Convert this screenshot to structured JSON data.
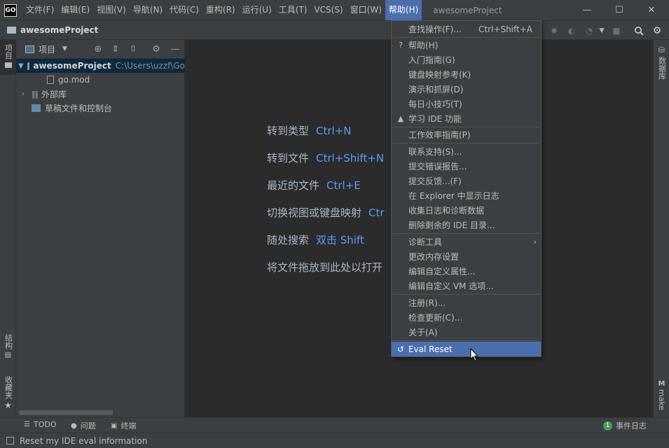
{
  "titlebar": {
    "logo": "GO",
    "menus": [
      "文件(F)",
      "编辑(E)",
      "视图(V)",
      "导航(N)",
      "代码(C)",
      "重构(R)",
      "运行(U)",
      "工具(T)",
      "VCS(S)",
      "窗口(W)",
      "帮助(H)"
    ],
    "active_menu": "帮助(H)",
    "window_title": "awesomeProject",
    "controls": {
      "minimize": "—",
      "maximize": "☐",
      "close": "✕"
    }
  },
  "navbar": {
    "project": "awesomeProject",
    "tool_icons": [
      "bug-icon",
      "coverage-icon",
      "profile-icon",
      "dropdown-icon",
      "stop-icon",
      "search-icon",
      "gear-icon"
    ]
  },
  "left_stripe": {
    "project_tab": "项目",
    "structure_tab": "结构",
    "favorites_tab": "收藏夹"
  },
  "right_stripe": {
    "database_tab": "数据库",
    "make_tab": "make"
  },
  "project_panel": {
    "title": "项目",
    "tree": {
      "root_name": "awesomeProject",
      "root_path": "C:\\Users\\uzzf\\Go",
      "child_file": "go.mod",
      "external_libs": "外部库",
      "scratches": "草稿文件和控制台"
    }
  },
  "editor": {
    "hints": [
      {
        "label": "转到类型",
        "key": "Ctrl+N"
      },
      {
        "label": "转到文件",
        "key": "Ctrl+Shift+N"
      },
      {
        "label": "最近的文件",
        "key": "Ctrl+E"
      },
      {
        "label": "切换视图或键盘映射",
        "key": "Ctr"
      },
      {
        "label": "随处搜索",
        "key": "双击 Shift"
      },
      {
        "label": "将文件拖放到此处以打开",
        "key": ""
      }
    ]
  },
  "help_menu": {
    "items": [
      {
        "label": "查找操作(F)...",
        "shortcut": "Ctrl+Shift+A"
      },
      {
        "label": "帮助(H)",
        "icon": "?"
      },
      {
        "label": "入门指南(G)"
      },
      {
        "label": "键盘映射参考(K)"
      },
      {
        "label": "演示和抓屏(D)"
      },
      {
        "label": "每日小技巧(T)"
      },
      {
        "label": "学习 IDE 功能",
        "icon": "🎓"
      },
      {
        "label": "工作效率指南(P)"
      },
      {
        "label": "联系支持(S)..."
      },
      {
        "label": "提交错误报告..."
      },
      {
        "label": "提交反馈...(F)"
      },
      {
        "label": "在 Explorer 中显示日志"
      },
      {
        "label": "收集日志和诊断数据"
      },
      {
        "label": "删除剩余的 IDE 目录..."
      },
      {
        "label": "诊断工具",
        "submenu": "›"
      },
      {
        "label": "更改内存设置"
      },
      {
        "label": "编辑自定义属性..."
      },
      {
        "label": "编辑自定义 VM 选项..."
      },
      {
        "label": "注册(R)..."
      },
      {
        "label": "检查更新(C)..."
      },
      {
        "label": "关于(A)"
      },
      {
        "label": "Eval Reset",
        "icon": "↺"
      }
    ]
  },
  "bottom_tools": {
    "todo": "TODO",
    "problems": "问题",
    "terminal": "终端",
    "event_log": "事件日志",
    "event_count": "1"
  },
  "status": {
    "text": "Reset my IDE eval information"
  }
}
